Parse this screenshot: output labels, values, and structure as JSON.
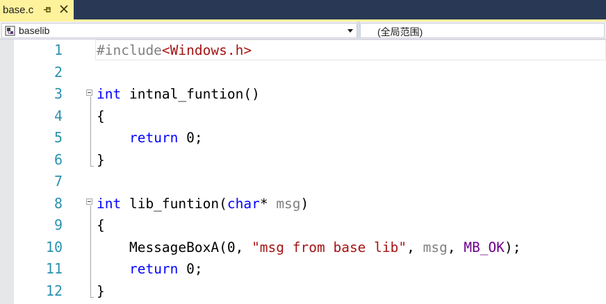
{
  "tab": {
    "title": "base.c"
  },
  "navbar": {
    "project": "baselib",
    "scope": "(全局范围)"
  },
  "editor": {
    "lines": [
      {
        "num": "1",
        "tokens": [
          [
            "pp",
            "#include"
          ],
          [
            "inc",
            "<Windows.h>"
          ]
        ]
      },
      {
        "num": "2",
        "tokens": []
      },
      {
        "num": "3",
        "tokens": [
          [
            "kw",
            "int"
          ],
          [
            "plain",
            " intnal_funtion()"
          ]
        ]
      },
      {
        "num": "4",
        "tokens": [
          [
            "plain",
            "{"
          ]
        ]
      },
      {
        "num": "5",
        "tokens": [
          [
            "plain",
            "    "
          ],
          [
            "kw",
            "return"
          ],
          [
            "plain",
            " 0;"
          ]
        ]
      },
      {
        "num": "6",
        "tokens": [
          [
            "plain",
            "}"
          ]
        ]
      },
      {
        "num": "7",
        "tokens": []
      },
      {
        "num": "8",
        "tokens": [
          [
            "kw",
            "int"
          ],
          [
            "plain",
            " lib_funtion("
          ],
          [
            "kw",
            "char"
          ],
          [
            "plain",
            "* "
          ],
          [
            "param",
            "msg"
          ],
          [
            "plain",
            ")"
          ]
        ]
      },
      {
        "num": "9",
        "tokens": [
          [
            "plain",
            "{"
          ]
        ]
      },
      {
        "num": "10",
        "tokens": [
          [
            "plain",
            "    MessageBoxA(0, "
          ],
          [
            "str",
            "\"msg from base lib\""
          ],
          [
            "plain",
            ", "
          ],
          [
            "param",
            "msg"
          ],
          [
            "plain",
            ", "
          ],
          [
            "macro",
            "MB_OK"
          ],
          [
            "plain",
            ");"
          ]
        ]
      },
      {
        "num": "11",
        "tokens": [
          [
            "plain",
            "    "
          ],
          [
            "kw",
            "return"
          ],
          [
            "plain",
            " 0;"
          ]
        ]
      },
      {
        "num": "12",
        "tokens": [
          [
            "plain",
            "}"
          ]
        ]
      }
    ]
  }
}
